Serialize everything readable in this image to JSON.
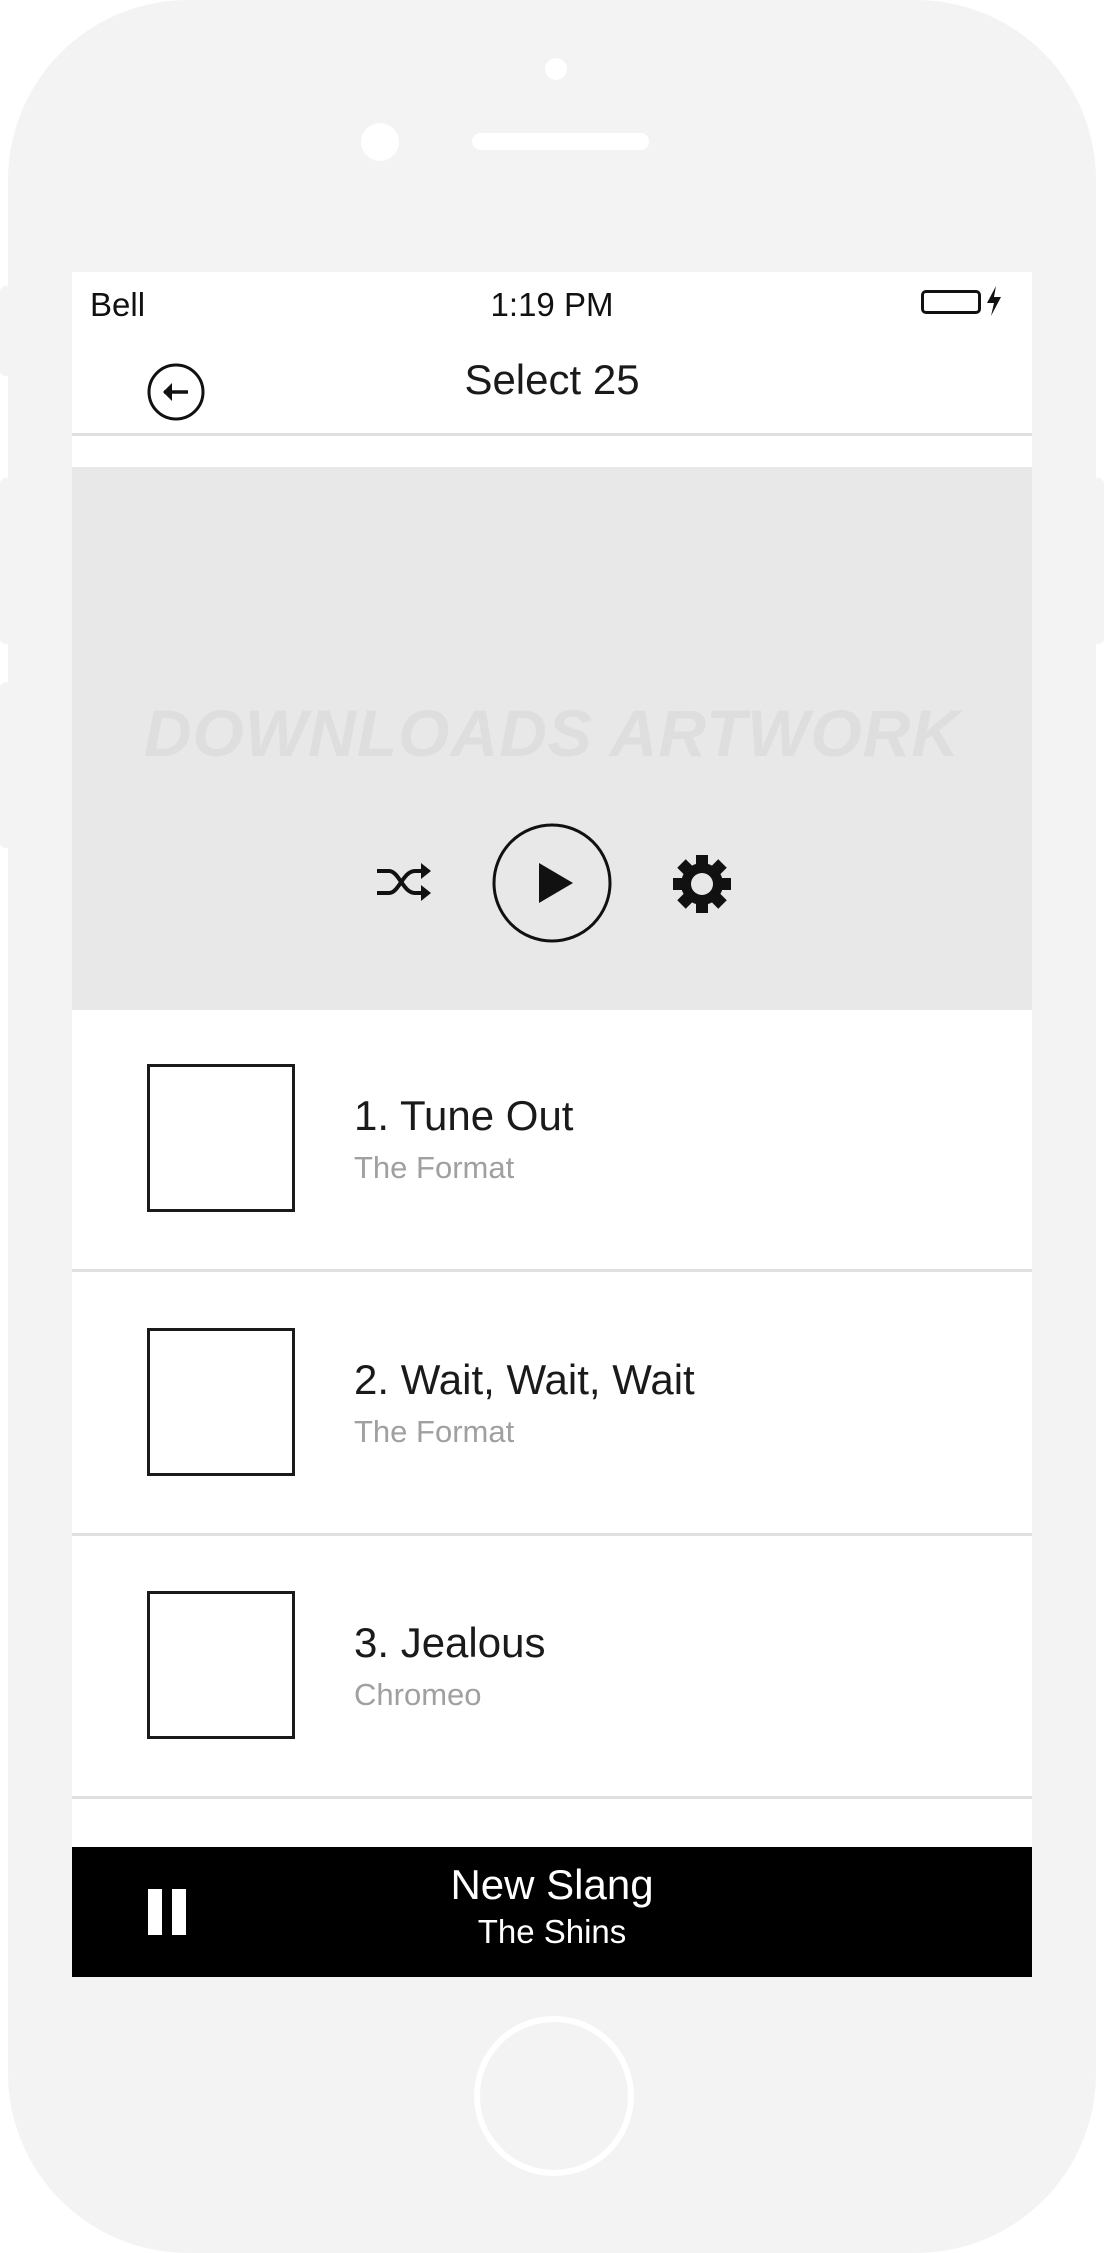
{
  "status_bar": {
    "carrier": "Bell",
    "time": "1:19 PM"
  },
  "nav": {
    "title": "Select 25",
    "back_icon": "back-arrow-icon"
  },
  "hero": {
    "placeholder": "DOWNLOADS ARTWORK",
    "controls": {
      "shuffle_icon": "shuffle-icon",
      "play_icon": "play-icon",
      "settings_icon": "gear-icon"
    }
  },
  "tracks": [
    {
      "title": "1. Tune Out",
      "artist": "The Format"
    },
    {
      "title": "2. Wait, Wait, Wait",
      "artist": "The Format"
    },
    {
      "title": "3. Jealous",
      "artist": "Chromeo"
    }
  ],
  "now_playing": {
    "title": "New Slang",
    "artist": "The Shins",
    "state_icon": "pause-icon"
  },
  "colors": {
    "device_frame": "#f3f3f3",
    "hero_background": "#e8e8e8",
    "player_background": "#000000",
    "secondary_text": "#a0a0a0",
    "divider": "#e0e0e0"
  }
}
